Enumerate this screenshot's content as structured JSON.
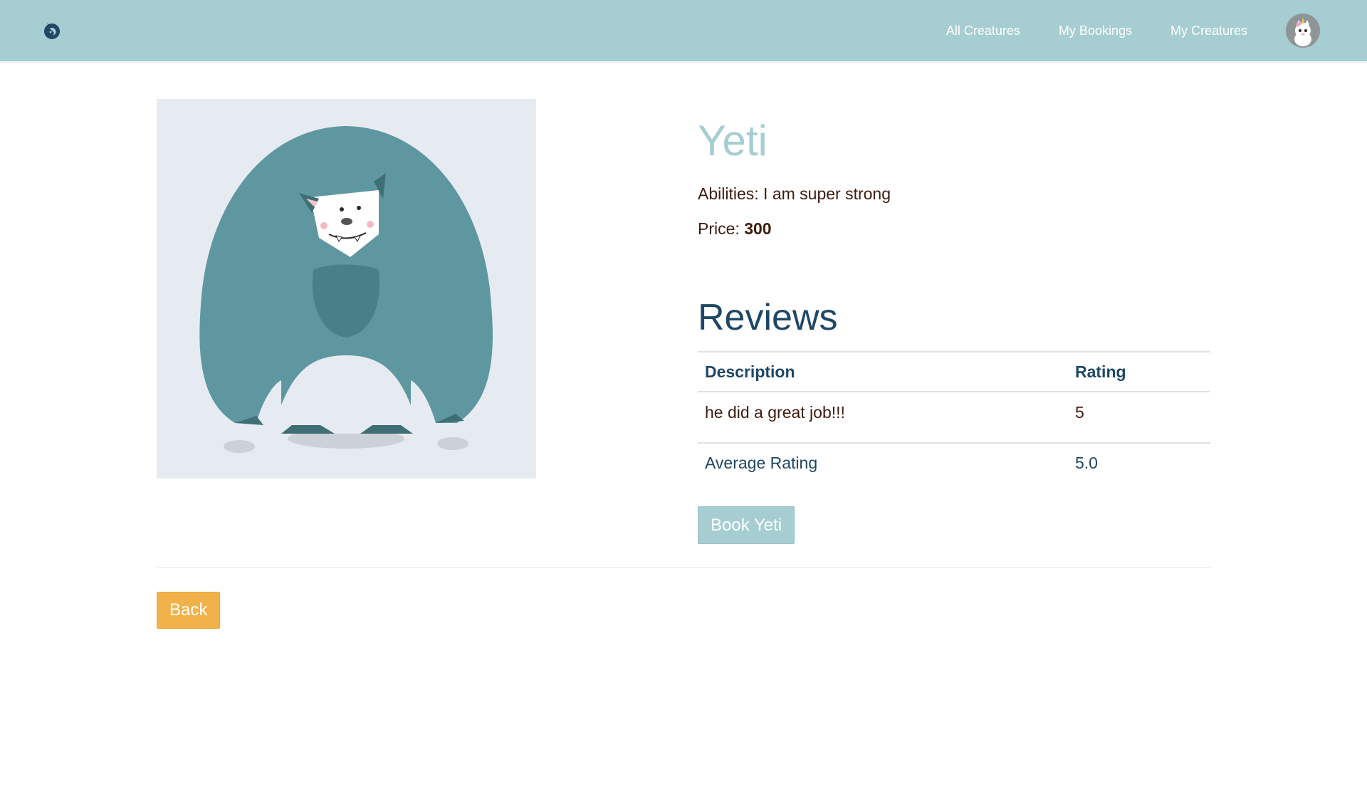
{
  "navbar": {
    "brand_icon": "unicorn-logo-icon",
    "links": [
      "All Creatures",
      "My Bookings",
      "My Creatures"
    ],
    "avatar_icon": "unicorn-avatar-icon",
    "background": "#a6cdd1"
  },
  "creature": {
    "name": "Yeti",
    "ability_label": "Abilities:",
    "ability_value": "I am super strong",
    "price_label": "Price:",
    "price_value": "300",
    "image_icon": "yeti-illustration"
  },
  "reviews": {
    "title": "Reviews",
    "columns": [
      "Description",
      "Rating"
    ],
    "rows": [
      {
        "description": "he did a great job!!!",
        "rating": "5"
      }
    ],
    "average_label": "Average Rating",
    "average_value": "5.0"
  },
  "actions": {
    "book_label": "Book Yeti",
    "back_label": "Back"
  },
  "colors": {
    "accent": "#a6cdd1",
    "heading": "#1f4766",
    "text": "#3d1c0f",
    "back_button": "#f1b24a"
  }
}
